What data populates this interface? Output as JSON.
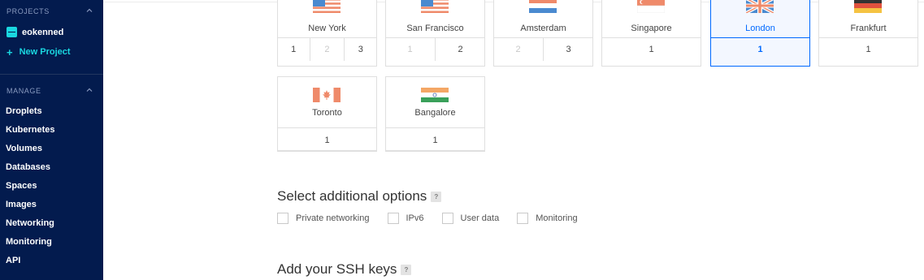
{
  "sidebar": {
    "projects_heading": "PROJECTS",
    "project_name": "eokenned",
    "new_project": "New Project",
    "manage_heading": "MANAGE",
    "menu": [
      "Droplets",
      "Kubernetes",
      "Volumes",
      "Databases",
      "Spaces",
      "Images",
      "Networking",
      "Monitoring",
      "API"
    ],
    "colors": {
      "bg": "#031b4e",
      "accent": "#1ad7e0"
    }
  },
  "datacenters": [
    {
      "name": "New York",
      "flag": "us-flag",
      "options": [
        {
          "label": "1",
          "dim": false
        },
        {
          "label": "2",
          "dim": true
        },
        {
          "label": "3",
          "dim": false
        }
      ]
    },
    {
      "name": "San Francisco",
      "flag": "us-flag",
      "options": [
        {
          "label": "1",
          "dim": true
        },
        {
          "label": "2",
          "dim": false
        }
      ]
    },
    {
      "name": "Amsterdam",
      "flag": "nl-flag",
      "options": [
        {
          "label": "2",
          "dim": true
        },
        {
          "label": "3",
          "dim": false
        }
      ]
    },
    {
      "name": "Singapore",
      "flag": "sg-flag",
      "options": [
        {
          "label": "1",
          "dim": false
        }
      ]
    },
    {
      "name": "London",
      "flag": "uk-flag",
      "selected": true,
      "options": [
        {
          "label": "1",
          "dim": false
        }
      ]
    },
    {
      "name": "Frankfurt",
      "flag": "de-flag",
      "options": [
        {
          "label": "1",
          "dim": false
        }
      ]
    },
    {
      "name": "Toronto",
      "flag": "ca-flag",
      "options": [
        {
          "label": "1",
          "dim": false
        }
      ]
    },
    {
      "name": "Bangalore",
      "flag": "in-flag",
      "options": [
        {
          "label": "1",
          "dim": false
        }
      ]
    }
  ],
  "additional_options": {
    "heading": "Select additional options",
    "help": "?",
    "items": [
      "Private networking",
      "IPv6",
      "User data",
      "Monitoring"
    ]
  },
  "ssh": {
    "heading": "Add your SSH keys",
    "help": "?"
  },
  "colors": {
    "selected": "#0069ff",
    "border": "#dfdfdf"
  }
}
